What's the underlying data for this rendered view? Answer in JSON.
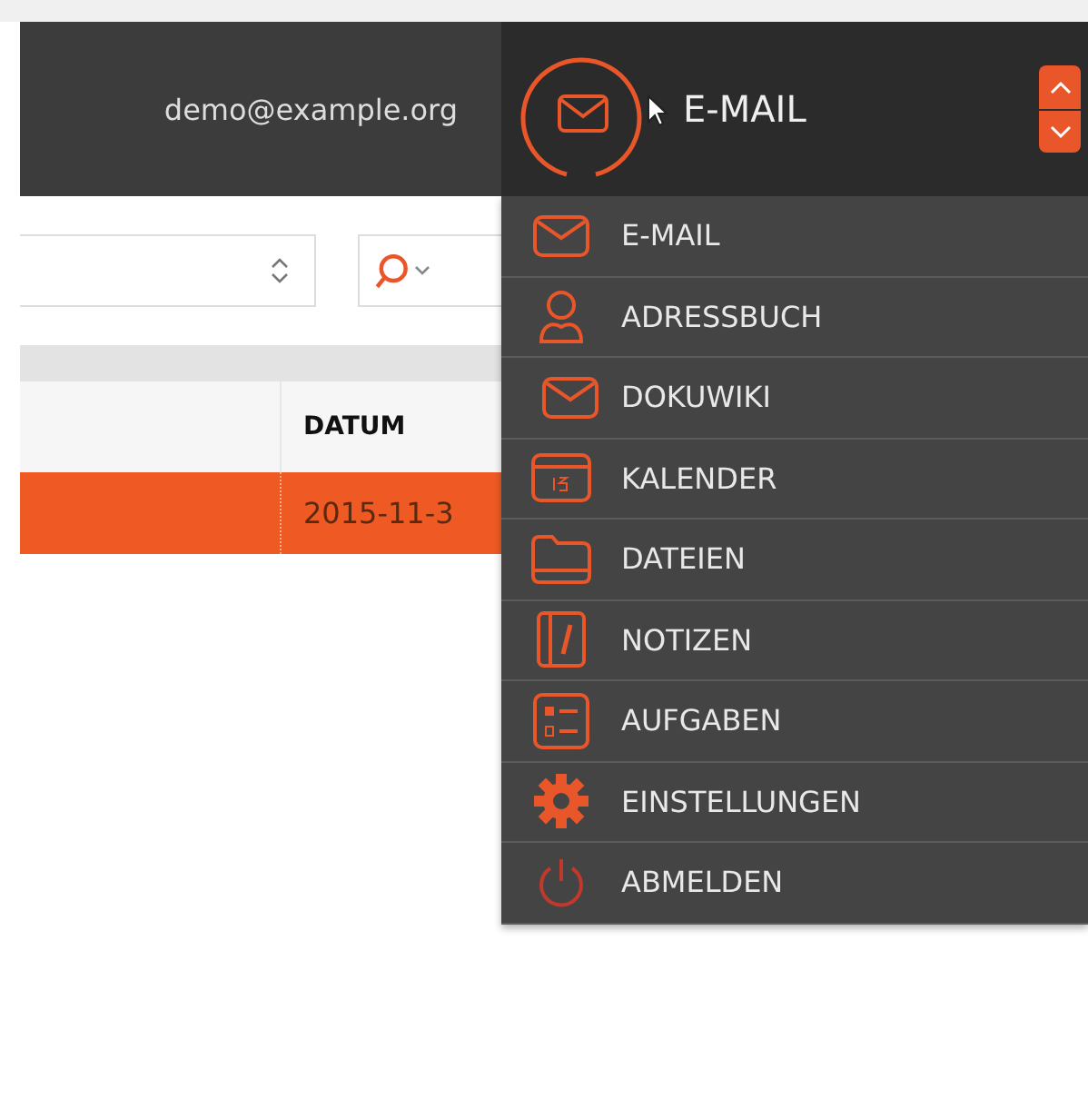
{
  "header": {
    "user_email": "demo@example.org",
    "current_app": "E-MAIL"
  },
  "table": {
    "columns": [
      {
        "label": "DATUM"
      }
    ],
    "rows": [
      {
        "selected": true,
        "cells": [
          "2015-11-3"
        ]
      }
    ]
  },
  "app_menu": {
    "items": [
      {
        "label": "E-MAIL"
      },
      {
        "label": "ADRESSBUCH"
      },
      {
        "label": "DOKUWIKI"
      },
      {
        "label": "KALENDER"
      },
      {
        "label": "DATEIEN"
      },
      {
        "label": "NOTIZEN"
      },
      {
        "label": "AUFGABEN"
      },
      {
        "label": "EINSTELLUNGEN"
      },
      {
        "label": "ABMELDEN"
      }
    ]
  }
}
